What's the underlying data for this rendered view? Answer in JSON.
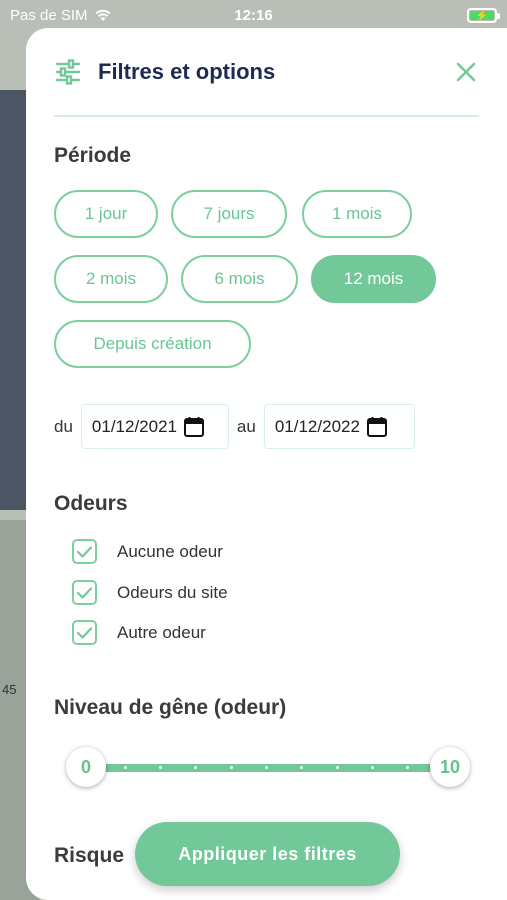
{
  "status_bar": {
    "carrier": "Pas de SIM",
    "time": "12:16"
  },
  "sheet": {
    "title": "Filtres et options"
  },
  "periode": {
    "title": "Période",
    "options": [
      "1 jour",
      "7 jours",
      "1 mois",
      "2 mois",
      "6 mois",
      "12 mois",
      "Depuis création"
    ],
    "selected": "12 mois"
  },
  "dates": {
    "from_label": "du",
    "from_value": "01/12/2021",
    "to_label": "au",
    "to_value": "01/12/2022"
  },
  "odeurs": {
    "title": "Odeurs",
    "items": [
      {
        "label": "Aucune odeur",
        "checked": true
      },
      {
        "label": "Odeurs du site",
        "checked": true
      },
      {
        "label": "Autre odeur",
        "checked": true
      }
    ]
  },
  "gene": {
    "title": "Niveau de gêne (odeur)",
    "min_value": "0",
    "max_value": "10"
  },
  "risque": {
    "title": "Risque"
  },
  "apply_label": "Appliquer les filtres",
  "map": {
    "partial_label": "45"
  },
  "colors": {
    "accent": "#72c898",
    "title": "#1c2b4f"
  }
}
